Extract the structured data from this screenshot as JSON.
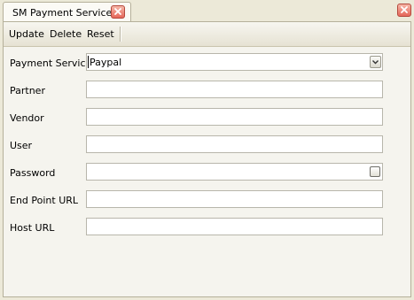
{
  "tab": {
    "title": "SM Payment Services",
    "close_icon": "close-icon"
  },
  "window": {
    "close_icon": "close-icon"
  },
  "toolbar": {
    "update_label": "Update",
    "delete_label": "Delete",
    "reset_label": "Reset"
  },
  "form": {
    "payment_service": {
      "label": "Payment Service",
      "value": "Paypal"
    },
    "partner": {
      "label": "Partner",
      "value": ""
    },
    "vendor": {
      "label": "Vendor",
      "value": ""
    },
    "user": {
      "label": "User",
      "value": ""
    },
    "password": {
      "label": "Password",
      "value": "",
      "show_password_checked": false
    },
    "end_point_url": {
      "label": "End Point URL",
      "value": ""
    },
    "host_url": {
      "label": "Host URL",
      "value": ""
    }
  },
  "colors": {
    "close_button": "#e5675a",
    "background": "#ece9d8",
    "panel": "#f5f4ee"
  }
}
